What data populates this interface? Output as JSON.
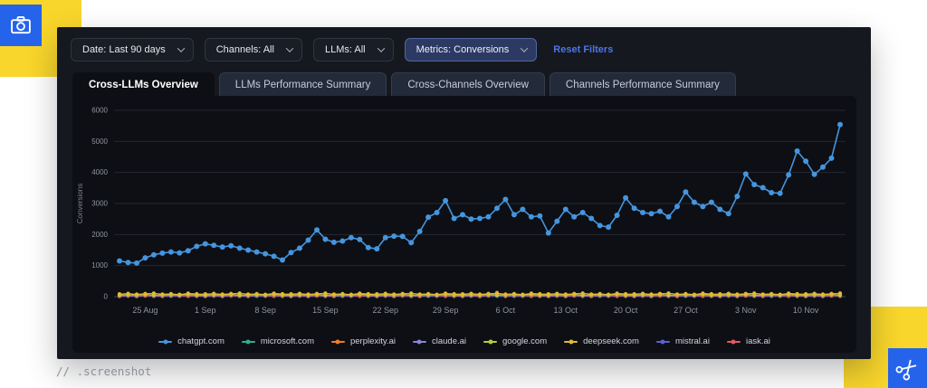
{
  "brand": {
    "accent_yellow": "#F8D62B",
    "accent_blue": "#2563EB",
    "icons": [
      "camera-icon",
      "scissors-icon",
      "chevron-down-icon"
    ]
  },
  "caption": "// .screenshot",
  "filters": {
    "items": [
      {
        "label": "Date: Last 90 days",
        "selected": false
      },
      {
        "label": "Channels: All",
        "selected": false
      },
      {
        "label": "LLMs: All",
        "selected": false
      },
      {
        "label": "Metrics: Conversions",
        "selected": true
      }
    ],
    "reset_label": "Reset Filters"
  },
  "tabs": {
    "items": [
      {
        "label": "Cross-LLMs Overview",
        "active": true
      },
      {
        "label": "LLMs Performance Summary",
        "active": false
      },
      {
        "label": "Cross-Channels Overview",
        "active": false
      },
      {
        "label": "Channels Performance Summary",
        "active": false
      }
    ]
  },
  "chart_data": {
    "type": "line",
    "title": "",
    "xlabel": "",
    "ylabel": "Conversions",
    "ylim": [
      0,
      6000
    ],
    "yticks": [
      0,
      1000,
      2000,
      3000,
      4000,
      5000,
      6000
    ],
    "grid": "horizontal",
    "legend_position": "bottom",
    "num_points": 85,
    "x_range_dates": [
      "22 Aug",
      "14 Nov"
    ],
    "x_tick_labels": [
      "25 Aug",
      "1 Sep",
      "8 Sep",
      "15 Sep",
      "22 Sep",
      "29 Sep",
      "6 Oct",
      "13 Oct",
      "20 Oct",
      "27 Oct",
      "3 Nov",
      "10 Nov"
    ],
    "x_tick_indices": [
      3,
      10,
      17,
      24,
      31,
      38,
      45,
      52,
      59,
      66,
      73,
      80
    ],
    "axis_colors": {
      "grid": "#23272F",
      "zero_line": "#3E444E",
      "tick_text": "#8F949D",
      "ylabel_text": "#7A8089"
    },
    "series": [
      {
        "name": "chatgpt.com",
        "color": "#4595DE",
        "draw_order": 8,
        "line_width": 1.6,
        "point_radius": 3,
        "values": [
          1150,
          1100,
          1080,
          1250,
          1350,
          1400,
          1440,
          1410,
          1480,
          1620,
          1700,
          1650,
          1600,
          1640,
          1560,
          1500,
          1440,
          1380,
          1300,
          1180,
          1420,
          1560,
          1820,
          2150,
          1850,
          1750,
          1790,
          1900,
          1840,
          1580,
          1540,
          1900,
          1950,
          1940,
          1740,
          2100,
          2560,
          2710,
          3090,
          2520,
          2640,
          2500,
          2520,
          2570,
          2850,
          3130,
          2640,
          2810,
          2570,
          2600,
          2050,
          2430,
          2810,
          2570,
          2710,
          2520,
          2290,
          2240,
          2620,
          3180,
          2850,
          2710,
          2670,
          2750,
          2570,
          2900,
          3370,
          3040,
          2900,
          3040,
          2810,
          2670,
          3230,
          3950,
          3610,
          3510,
          3350,
          3330,
          3920,
          4690,
          4360,
          3940,
          4170,
          4460,
          5540
        ]
      },
      {
        "name": "microsoft.com",
        "color": "#2EAE8F",
        "draw_order": 1,
        "line_width": 1,
        "point_radius": 2.1,
        "values": [
          15,
          28,
          12,
          32,
          20,
          25,
          18,
          35,
          22,
          16,
          15,
          28,
          12,
          32,
          20,
          25,
          18,
          35,
          22,
          16,
          15,
          28,
          12,
          32,
          20,
          25,
          18,
          35,
          22,
          16,
          15,
          28,
          12,
          32,
          20,
          25,
          18,
          35,
          22,
          16,
          15,
          28,
          12,
          32,
          20,
          25,
          18,
          35,
          22,
          16,
          15,
          28,
          12,
          32,
          20,
          25,
          18,
          35,
          22,
          16,
          15,
          28,
          12,
          32,
          20,
          25,
          18,
          35,
          22,
          16,
          15,
          28,
          12,
          32,
          20,
          25,
          18,
          35,
          22,
          16,
          15,
          28,
          12,
          32,
          20
        ]
      },
      {
        "name": "perplexity.ai",
        "color": "#EF7D2B",
        "draw_order": 5,
        "line_width": 1,
        "point_radius": 2.1,
        "values": [
          45,
          60,
          38,
          55,
          70,
          42,
          65,
          50,
          58,
          35,
          45,
          60,
          38,
          55,
          70,
          42,
          65,
          50,
          58,
          35,
          45,
          60,
          38,
          55,
          70,
          42,
          65,
          50,
          58,
          35,
          45,
          60,
          38,
          55,
          70,
          42,
          65,
          50,
          58,
          35,
          45,
          60,
          38,
          55,
          70,
          42,
          65,
          50,
          58,
          35,
          45,
          60,
          38,
          55,
          70,
          42,
          65,
          50,
          58,
          35,
          45,
          60,
          38,
          55,
          70,
          42,
          65,
          50,
          58,
          35,
          45,
          60,
          38,
          55,
          70,
          42,
          65,
          50,
          58,
          35,
          45,
          60,
          38,
          55,
          70
        ]
      },
      {
        "name": "claude.ai",
        "color": "#8A84DE",
        "draw_order": 4,
        "line_width": 1,
        "point_radius": 2.1,
        "values": [
          30,
          45,
          25,
          50,
          38,
          28,
          42,
          35,
          55,
          32,
          30,
          45,
          25,
          50,
          38,
          28,
          42,
          35,
          55,
          32,
          30,
          45,
          25,
          50,
          38,
          28,
          42,
          35,
          55,
          32,
          30,
          45,
          25,
          50,
          38,
          28,
          42,
          35,
          55,
          32,
          30,
          45,
          25,
          50,
          38,
          28,
          42,
          35,
          55,
          32,
          30,
          45,
          25,
          50,
          38,
          28,
          42,
          35,
          55,
          32,
          30,
          45,
          25,
          50,
          38,
          28,
          42,
          35,
          55,
          32,
          30,
          45,
          25,
          50,
          38,
          28,
          42,
          35,
          55,
          32,
          30,
          45,
          25,
          50,
          38
        ]
      },
      {
        "name": "google.com",
        "color": "#B9CE33",
        "draw_order": 6,
        "line_width": 1,
        "point_radius": 2.1,
        "values": [
          55,
          70,
          62,
          80,
          48,
          66,
          74,
          58,
          85,
          60,
          55,
          70,
          62,
          80,
          48,
          66,
          74,
          58,
          85,
          60,
          55,
          70,
          62,
          80,
          48,
          66,
          74,
          58,
          85,
          60,
          55,
          70,
          62,
          80,
          48,
          66,
          74,
          58,
          85,
          60,
          55,
          70,
          62,
          80,
          48,
          66,
          74,
          58,
          85,
          60,
          55,
          70,
          62,
          80,
          48,
          66,
          74,
          58,
          85,
          60,
          55,
          70,
          62,
          80,
          48,
          66,
          74,
          58,
          85,
          60,
          55,
          70,
          62,
          80,
          48,
          66,
          74,
          58,
          85,
          60,
          55,
          70,
          62,
          80,
          48
        ]
      },
      {
        "name": "deepseek.com",
        "color": "#E6B92F",
        "draw_order": 7,
        "line_width": 1,
        "point_radius": 2.1,
        "values": [
          85,
          100,
          75,
          95,
          110,
          80,
          90,
          70,
          105,
          88,
          85,
          100,
          75,
          95,
          110,
          80,
          90,
          70,
          105,
          88,
          85,
          100,
          75,
          95,
          110,
          80,
          90,
          70,
          105,
          88,
          85,
          100,
          75,
          95,
          110,
          80,
          90,
          70,
          105,
          88,
          85,
          100,
          75,
          95,
          110,
          80,
          90,
          70,
          105,
          88,
          85,
          100,
          75,
          95,
          110,
          80,
          90,
          70,
          105,
          88,
          85,
          100,
          75,
          95,
          110,
          80,
          90,
          70,
          105,
          88,
          85,
          100,
          75,
          95,
          110,
          80,
          90,
          70,
          105,
          88,
          85,
          100,
          75,
          95,
          110
        ]
      },
      {
        "name": "mistral.ai",
        "color": "#5B60D6",
        "draw_order": 3,
        "line_width": 1,
        "point_radius": 2.1,
        "values": [
          22,
          35,
          18,
          40,
          28,
          24,
          38,
          20,
          45,
          30,
          22,
          35,
          18,
          40,
          28,
          24,
          38,
          20,
          45,
          30,
          22,
          35,
          18,
          40,
          28,
          24,
          38,
          20,
          45,
          30,
          22,
          35,
          18,
          40,
          28,
          24,
          38,
          20,
          45,
          30,
          22,
          35,
          18,
          40,
          28,
          24,
          38,
          20,
          45,
          30,
          22,
          35,
          18,
          40,
          28,
          24,
          38,
          20,
          45,
          30,
          22,
          35,
          18,
          40,
          28,
          24,
          38,
          20,
          45,
          30,
          22,
          35,
          18,
          40,
          28,
          24,
          38,
          20,
          45,
          30,
          22,
          35,
          18,
          40,
          28
        ]
      },
      {
        "name": "iask.ai",
        "color": "#E05A62",
        "draw_order": 2,
        "line_width": 1,
        "point_radius": 2.1,
        "values": [
          10,
          20,
          8,
          25,
          15,
          12,
          30,
          18,
          14,
          22,
          10,
          20,
          8,
          25,
          15,
          12,
          30,
          18,
          14,
          22,
          10,
          20,
          8,
          25,
          15,
          12,
          30,
          18,
          14,
          22,
          10,
          20,
          8,
          25,
          15,
          12,
          30,
          18,
          14,
          22,
          10,
          20,
          8,
          25,
          130,
          12,
          30,
          18,
          14,
          22,
          10,
          20,
          8,
          25,
          15,
          12,
          30,
          18,
          14,
          22,
          10,
          20,
          8,
          25,
          15,
          12,
          30,
          18,
          14,
          22,
          10,
          20,
          8,
          25,
          15,
          12,
          30,
          18,
          14,
          22,
          10,
          20,
          8,
          25,
          15
        ]
      }
    ]
  }
}
